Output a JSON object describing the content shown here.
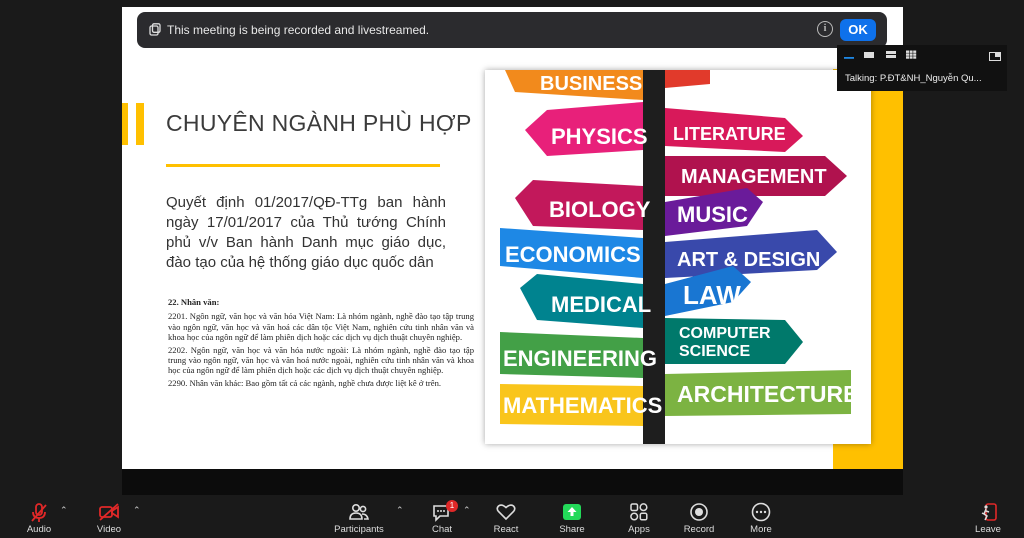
{
  "banner": {
    "text": "This meeting is being recorded and livestreamed.",
    "ok_label": "OK"
  },
  "speaker": {
    "talking": "Talking:  P.ĐT&NH_Nguyễn  Qu..."
  },
  "slide": {
    "title": "CHUYÊN NGÀNH PHÙ HỢP",
    "quote": "Quyết định 01/2017/QĐ-TTg ban hành ngày 17/01/2017 của Thủ tướng Chính phủ v/v Ban hành Danh mục giáo dục, đào tạo của hệ thống giáo dục quốc dân",
    "legal_heading": "22. Nhân văn:",
    "legal_p1": "2201. Ngôn ngữ, văn học và văn hóa Việt Nam: Là nhóm ngành, nghề đào tạo tập trung vào ngôn ngữ, văn học và văn hoá các dân tộc Việt Nam, nghiên cứu tinh nhân văn và khoa học của ngôn ngữ để làm phiên dịch hoặc các dịch vụ dịch thuật chuyên nghiệp.",
    "legal_p2": "2202. Ngôn ngữ, văn học và văn hóa nước ngoài: Là nhóm ngành, nghề đào tạo tập trung vào ngôn ngữ, văn học và văn hoá nước ngoài, nghiên cứu tinh nhân văn và khoa học của ngôn ngữ để làm phiên dịch hoặc các dịch vụ dịch thuật chuyên nghiệp.",
    "legal_p3": "2290. Nhân văn khác: Bao gồm tất cả các ngành, nghề chưa được liệt kê ở trên.",
    "signs": {
      "business": "BUSINESS",
      "physics": "PHYSICS",
      "literature": "LITERATURE",
      "management": "MANAGEMENT",
      "biology": "BIOLOGY",
      "music": "MUSIC",
      "economics": "ECONOMICS",
      "art": "ART & DESIGN",
      "law": "LAW",
      "medical": "MEDICAL",
      "computer1": "COMPUTER",
      "computer2": "SCIENCE",
      "engineering": "ENGINEERING",
      "architecture": "ARCHITECTURE",
      "mathematics": "MATHEMATICS"
    }
  },
  "toolbar": {
    "audio": "Audio",
    "video": "Video",
    "participants": "Participants",
    "chat": "Chat",
    "chat_badge": "1",
    "react": "React",
    "share": "Share",
    "apps": "Apps",
    "record": "Record",
    "more": "More",
    "leave": "Leave"
  },
  "colors": {
    "accent": "#ffc000",
    "ok_button": "#0e71eb",
    "share_green": "#23d959",
    "mute_red": "#e02828"
  }
}
